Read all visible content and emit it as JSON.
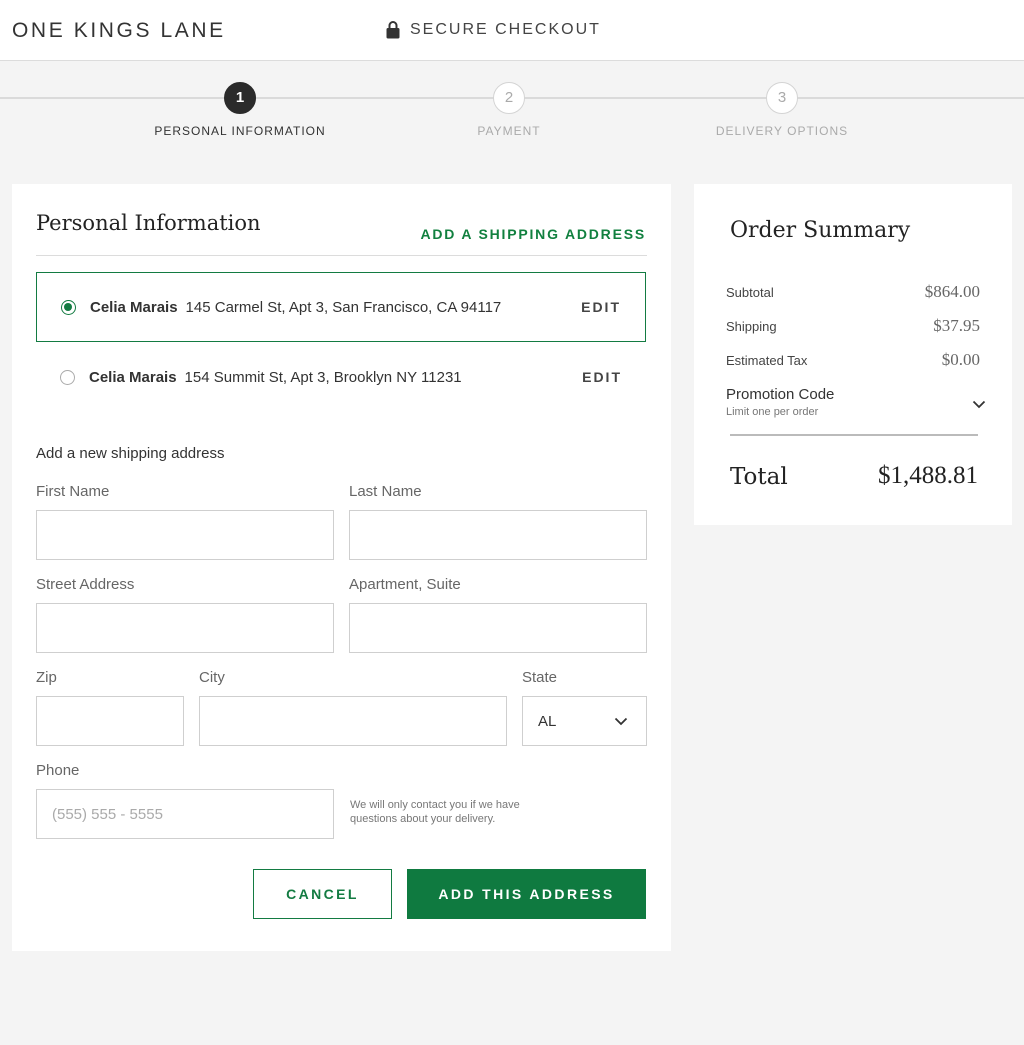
{
  "header": {
    "logo": "ONE KINGS LANE",
    "secure_label": "SECURE CHECKOUT"
  },
  "steps": [
    {
      "number": "1",
      "label": "PERSONAL INFORMATION",
      "active": true
    },
    {
      "number": "2",
      "label": "PAYMENT",
      "active": false
    },
    {
      "number": "3",
      "label": "DELIVERY OPTIONS",
      "active": false
    }
  ],
  "personal": {
    "title": "Personal Information",
    "add_shipping_link": "ADD A SHIPPING ADDRESS",
    "addresses": [
      {
        "name": "Celia Marais",
        "address": "145 Carmel St, Apt 3, San Francisco, CA 94117",
        "edit_label": "EDIT",
        "selected": true
      },
      {
        "name": "Celia Marais",
        "address": "154 Summit St, Apt 3, Brooklyn NY 11231",
        "edit_label": "EDIT",
        "selected": false
      }
    ]
  },
  "new_address": {
    "heading": "Add a new shipping address",
    "first_name_label": "First Name",
    "last_name_label": "Last Name",
    "street_label": "Street Address",
    "apartment_label": "Apartment, Suite",
    "zip_label": "Zip",
    "city_label": "City",
    "state_label": "State",
    "state_value": "AL",
    "phone_label": "Phone",
    "phone_placeholder": "(555)  555 - 5555",
    "phone_note": "We will only contact you if we have questions about your delivery.",
    "cancel_label": "CANCEL",
    "submit_label": "ADD THIS ADDRESS"
  },
  "summary": {
    "title": "Order Summary",
    "subtotal_label": "Subtotal",
    "subtotal_value": "$864.00",
    "shipping_label": "Shipping",
    "shipping_value": "$37.95",
    "tax_label": "Estimated Tax",
    "tax_value": "$0.00",
    "promo_title": "Promotion Code",
    "promo_sub": "Limit one per order",
    "total_label": "Total",
    "total_value": "$1,488.81"
  },
  "colors": {
    "accent_green": "#0f7a40",
    "dark": "#2b2b2b",
    "background": "#f4f4f4"
  },
  "icons": {
    "secure": "lock-icon",
    "state_select": "chevron-down-icon",
    "promo_toggle": "chevron-down-icon"
  }
}
